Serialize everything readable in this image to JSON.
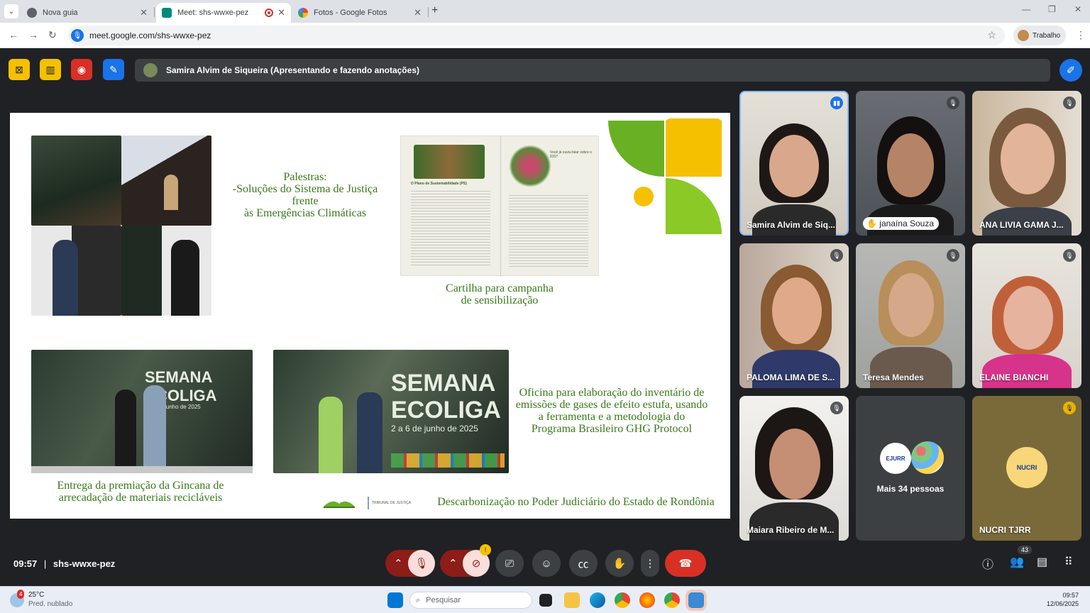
{
  "browser": {
    "tabs": [
      {
        "title": "Nova guia",
        "active": false
      },
      {
        "title": "Meet: shs-wwxe-pez",
        "active": true
      },
      {
        "title": "Fotos - Google Fotos",
        "active": false
      }
    ],
    "url": "meet.google.com/shs-wwxe-pez",
    "profile_label": "Trabalho"
  },
  "meet": {
    "presenter_bar": "Samira Alvim de Siqueira (Apresentando e fazendo anotações)",
    "time": "09:57",
    "meeting_code": "shs-wwxe-pez",
    "participants_count": "43",
    "cam_warning": "!",
    "participants": [
      {
        "name": "Samira Alvim de Siq...",
        "speaking": true
      },
      {
        "name": "janaína Souza",
        "hand_raised": true
      },
      {
        "name": "ANA LIVIA GAMA J..."
      },
      {
        "name": "PALOMA LIMA DE S..."
      },
      {
        "name": "Teresa Mendes"
      },
      {
        "name": "ELAINE BIANCHI"
      },
      {
        "name": "Maiara Ribeiro de M..."
      },
      {
        "name": "Mais 34 pessoas",
        "avatars": [
          "EJURR",
          ""
        ]
      },
      {
        "name": "NUCRI TJRR",
        "avatar_text": "NUCRI"
      }
    ]
  },
  "slide": {
    "palestras": "Palestras:",
    "palestras_line2": "-Soluções do Sistema de Justiça frente",
    "palestras_line3": "às Emergências Climáticas",
    "cartilha_line1": "Cartilha  para campanha",
    "cartilha_line2": "de sensibilização",
    "oficina_line1": "Oficina para elaboração do inventário de",
    "oficina_line2": "emissões de gases de efeito estufa, usando",
    "oficina_line3": "a ferramenta e a metodologia do",
    "oficina_line4": "Programa Brasileiro GHG Protocol",
    "entrega_line1": "Entrega da premiação da Gincana de",
    "entrega_line2": "arrecadação de materiais recicláveis",
    "footer": "Descarbonização no Poder Judiciário do Estado de Rondônia",
    "footer_logo_2": "TRIBUNAL DE JUSTIÇA",
    "banner1_line1": "SEMANA",
    "banner1_line2": "COLIGA",
    "banner1_date": "junho de 2025",
    "banner2_line1": "SEMANA",
    "banner2_line2": "ECOLIGA",
    "banner2_date": "2 a 6 de junho de 2025",
    "booklet_heading": "O Plano de Sustentabilidade (PS)",
    "booklet_q": "Você já ouviu falar sobre o IDS?"
  },
  "taskbar": {
    "weather_temp": "25°C",
    "weather_desc": "Pred. nublado",
    "weather_badge": "4",
    "search_placeholder": "Pesquisar",
    "clock_time": "09:57",
    "clock_date": "12/06/2025"
  },
  "colors": {
    "accent": "#1a73e8",
    "slide_green": "#3a7a1a",
    "leaf_green": "#6ab023",
    "leaf_yellow": "#f5c000",
    "hangup": "#d93025"
  }
}
